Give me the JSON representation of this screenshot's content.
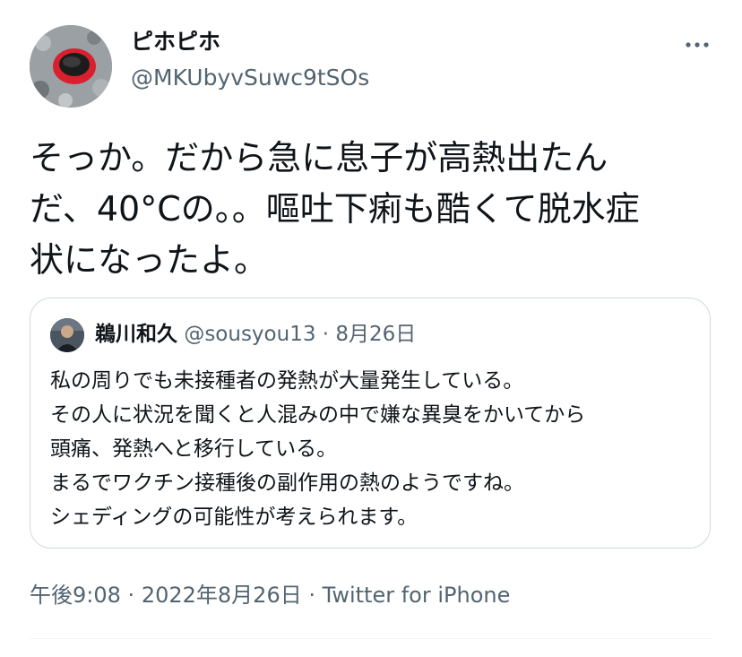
{
  "author": {
    "display_name": "ピホピホ",
    "handle": "@MKUbyvSuwc9tSOs",
    "avatar_icon": "avatar-photo-icon"
  },
  "more_icon": "more-horizontal-icon",
  "tweet": {
    "text_lines": [
      "そっか。だから急に息子が高熱出たん",
      "だ、40°Cの。。嘔吐下痢も酷くて脱水症",
      "状になったよ。"
    ]
  },
  "quoted_tweet": {
    "display_name": "鵜川和久",
    "handle": "@sousyou13",
    "separator": "·",
    "date": "8月26日",
    "lines": [
      "私の周りでも未接種者の発熱が大量発生している。",
      "その人に状況を聞くと人混みの中で嫌な異臭をかいてから",
      "頭痛、発熱へと移行している。",
      "まるでワクチン接種後の副作用の熱のようですね。",
      "シェディングの可能性が考えられます。"
    ]
  },
  "footer": {
    "time": "午後9:08",
    "separator": "·",
    "date": "2022年8月26日",
    "source": "Twitter for iPhone"
  },
  "colors": {
    "text": "#0f1419",
    "secondary": "#536471",
    "border": "#cfd9de"
  }
}
